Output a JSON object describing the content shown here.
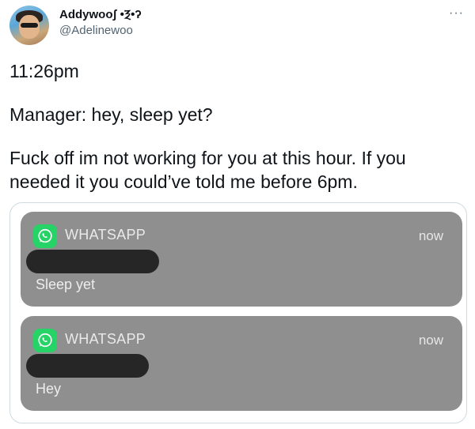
{
  "tweet": {
    "display_name": "Addywooʃ •Ⲝ•ʔ",
    "handle": "@Adelinewoo",
    "more_icon": "ellipsis-icon",
    "lines": {
      "time": "11:26pm",
      "manager": "Manager: hey, sleep yet?",
      "reply": "Fuck off im not working for you at this hour. If you needed it you could’ve told me before 6pm."
    }
  },
  "media": {
    "notifications": [
      {
        "app": "WHATSAPP",
        "time": "now",
        "message": "Sleep yet",
        "icon": "whatsapp-icon"
      },
      {
        "app": "WHATSAPP",
        "time": "now",
        "message": "Hey",
        "icon": "whatsapp-icon"
      }
    ],
    "colors": {
      "card": "#8f8f8f",
      "redaction": "#262626",
      "whatsapp_green": "#25d366"
    }
  }
}
